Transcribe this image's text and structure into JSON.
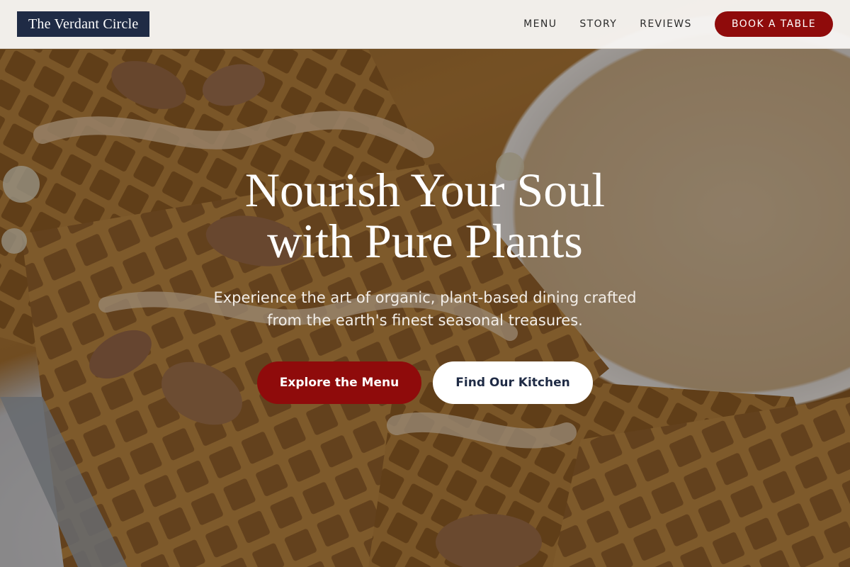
{
  "header": {
    "logo_text": "The Verdant Circle",
    "nav": [
      {
        "label": "MENU"
      },
      {
        "label": "STORY"
      },
      {
        "label": "REVIEWS"
      }
    ],
    "book_label": "BOOK A TABLE"
  },
  "hero": {
    "title_line1": "Nourish Your Soul",
    "title_line2": "with Pure Plants",
    "subtitle_line1": "Experience the art of organic, plant-based dining crafted",
    "subtitle_line2": "from the earth's finest seasonal treasures.",
    "primary_cta": "Explore the Menu",
    "secondary_cta": "Find Our Kitchen",
    "background_image": "waffles with pecans and maple cream sauce"
  },
  "colors": {
    "brand_red": "#8f0b0b",
    "logo_navy": "#1f2b45",
    "header_bg": "#f7f5f3"
  }
}
